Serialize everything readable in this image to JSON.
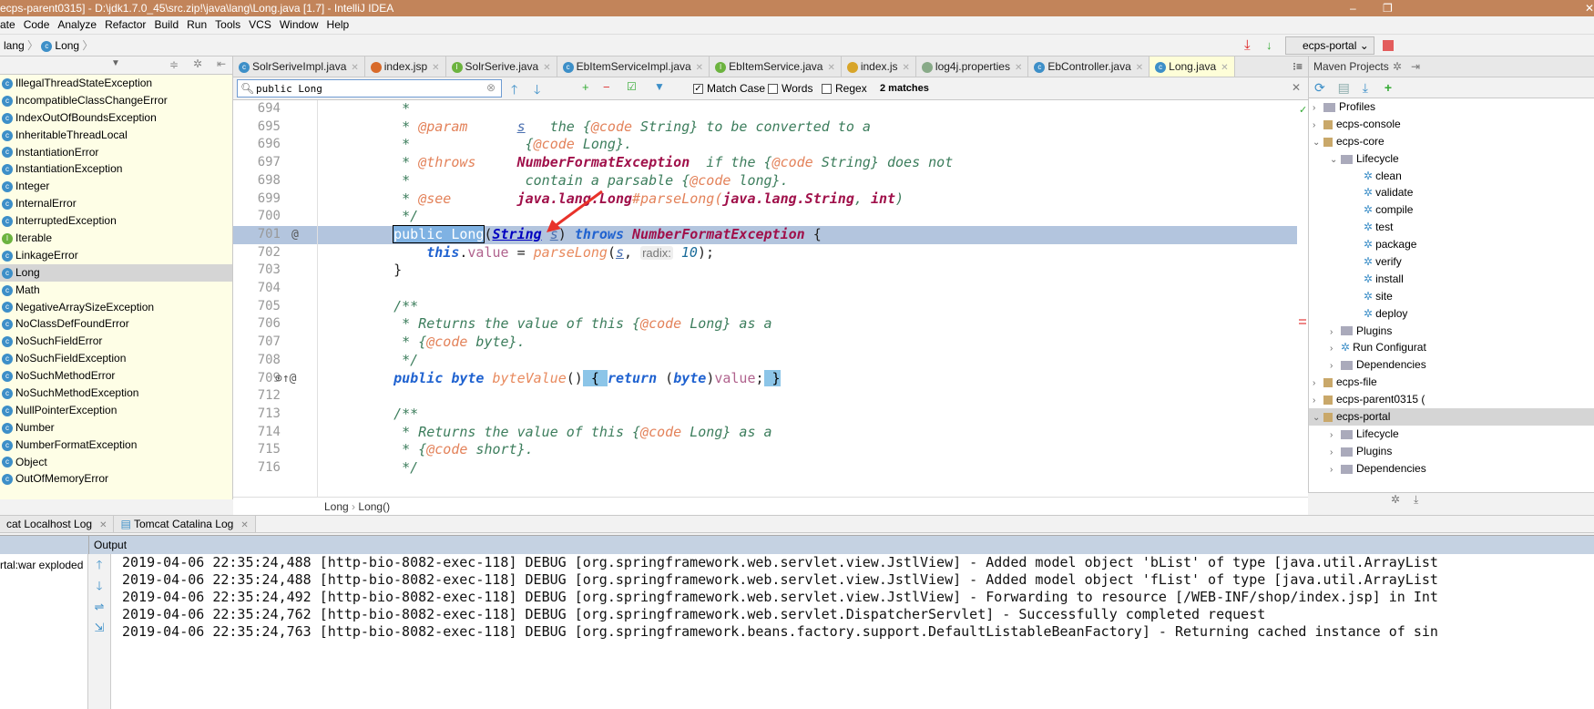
{
  "window": {
    "title": "ecps-parent0315] - D:\\jdk1.7.0_45\\src.zip!\\java\\lang\\Long.java [1.7] - IntelliJ IDEA",
    "minimize": "–",
    "restore": "❐",
    "close": "✕"
  },
  "menu": [
    "ate",
    "Code",
    "Analyze",
    "Refactor",
    "Build",
    "Run",
    "Tools",
    "VCS",
    "Window",
    "Help"
  ],
  "breadcrumb": {
    "items": [
      "lang",
      "Long"
    ],
    "run_config": "ecps-portal"
  },
  "left_panel": {
    "items": [
      "IllegalThreadStateException",
      "IncompatibleClassChangeError",
      "IndexOutOfBoundsException",
      "InheritableThreadLocal",
      "InstantiationError",
      "InstantiationException",
      "Integer",
      "InternalError",
      "InterruptedException",
      "Iterable",
      "LinkageError",
      "Long",
      "Math",
      "NegativeArraySizeException",
      "NoClassDefFoundError",
      "NoSuchFieldError",
      "NoSuchFieldException",
      "NoSuchMethodError",
      "NoSuchMethodException",
      "NullPointerException",
      "Number",
      "NumberFormatException",
      "Object",
      "OutOfMemoryError"
    ],
    "selected": "Long"
  },
  "tabs": [
    {
      "label": "SolrSeriveImpl.java",
      "icon": "c"
    },
    {
      "label": "index.jsp",
      "icon": "jsp"
    },
    {
      "label": "SolrSerive.java",
      "icon": "i"
    },
    {
      "label": "EbItemServiceImpl.java",
      "icon": "c"
    },
    {
      "label": "EbItemService.java",
      "icon": "i"
    },
    {
      "label": "index.js",
      "icon": "js"
    },
    {
      "label": "log4j.properties",
      "icon": "prop"
    },
    {
      "label": "EbController.java",
      "icon": "c"
    },
    {
      "label": "Long.java",
      "icon": "c",
      "active": true
    }
  ],
  "search": {
    "value": "public Long",
    "match_case": "Match Case",
    "match_case_checked": true,
    "words": "Words",
    "regex": "Regex",
    "result": "2 matches"
  },
  "code": [
    {
      "n": "694",
      "t": [
        [
          "cm",
          "     *"
        ]
      ]
    },
    {
      "n": "695",
      "t": [
        [
          "cm",
          "     * "
        ],
        [
          "tag",
          "@param"
        ],
        [
          "cm",
          "      "
        ],
        [
          "par",
          "s"
        ],
        [
          "cm",
          "   the {"
        ],
        [
          "tag",
          "@code"
        ],
        [
          "cm",
          " String} to be converted to a"
        ]
      ]
    },
    {
      "n": "696",
      "t": [
        [
          "cm",
          "     *              {"
        ],
        [
          "tag",
          "@code"
        ],
        [
          "cm",
          " Long}."
        ]
      ]
    },
    {
      "n": "697",
      "t": [
        [
          "cm",
          "     * "
        ],
        [
          "tag",
          "@throws"
        ],
        [
          "cm",
          "     "
        ],
        [
          "ref",
          "NumberFormatException"
        ],
        [
          "cm",
          "  if the {"
        ],
        [
          "tag",
          "@code"
        ],
        [
          "cm",
          " String} does not"
        ]
      ]
    },
    {
      "n": "698",
      "t": [
        [
          "cm",
          "     *              contain a parsable {"
        ],
        [
          "tag",
          "@code"
        ],
        [
          "cm",
          " long}."
        ]
      ]
    },
    {
      "n": "699",
      "t": [
        [
          "cm",
          "     * "
        ],
        [
          "tag",
          "@see"
        ],
        [
          "cm",
          "        "
        ],
        [
          "ref",
          "java.lang.Long"
        ],
        [
          "tag",
          "#parseLong("
        ],
        [
          "ref",
          "java.lang.String"
        ],
        [
          "cm",
          ", "
        ],
        [
          "ref",
          "int"
        ],
        [
          "cm",
          ")"
        ]
      ]
    },
    {
      "n": "700",
      "t": [
        [
          "cm",
          "     */"
        ]
      ]
    },
    {
      "n": "701",
      "hl": true,
      "g": "@",
      "t": [
        [
          "plain",
          "    "
        ],
        [
          "selm",
          "public Long"
        ],
        [
          "plain",
          "("
        ],
        [
          "cls",
          "String"
        ],
        [
          "plain",
          " "
        ],
        [
          "par",
          "s"
        ],
        [
          "plain",
          ") "
        ],
        [
          "kw",
          "throws"
        ],
        [
          "plain",
          " "
        ],
        [
          "ref",
          "NumberFormatException"
        ],
        [
          "plain",
          " {"
        ]
      ]
    },
    {
      "n": "702",
      "t": [
        [
          "plain",
          "        "
        ],
        [
          "kw",
          "this"
        ],
        [
          "plain",
          "."
        ],
        [
          "fld",
          "value"
        ],
        [
          "plain",
          " = "
        ],
        [
          "mth",
          "parseLong"
        ],
        [
          "plain",
          "("
        ],
        [
          "par",
          "s"
        ],
        [
          "plain",
          ", "
        ],
        [
          "hint",
          "radix:"
        ],
        [
          "num",
          " 10"
        ],
        [
          "plain",
          ");"
        ]
      ]
    },
    {
      "n": "703",
      "t": [
        [
          "plain",
          "    }"
        ]
      ]
    },
    {
      "n": "704",
      "t": []
    },
    {
      "n": "705",
      "t": [
        [
          "cm",
          "    /**"
        ]
      ]
    },
    {
      "n": "706",
      "t": [
        [
          "cm",
          "     * Returns the value of this {"
        ],
        [
          "tag",
          "@code"
        ],
        [
          "cm",
          " Long} as a"
        ]
      ]
    },
    {
      "n": "707",
      "t": [
        [
          "cm",
          "     * {"
        ],
        [
          "tag",
          "@code"
        ],
        [
          "cm",
          " byte}."
        ]
      ]
    },
    {
      "n": "708",
      "t": [
        [
          "cm",
          "     */"
        ]
      ]
    },
    {
      "n": "709",
      "g": "⊙↑@",
      "t": [
        [
          "plain",
          "    "
        ],
        [
          "kw",
          "public byte"
        ],
        [
          "plain",
          " "
        ],
        [
          "mth",
          "byteValue"
        ],
        [
          "plain",
          "()"
        ],
        [
          "brace",
          " { "
        ],
        [
          "kw",
          "return"
        ],
        [
          "plain",
          " ("
        ],
        [
          "kw",
          "byte"
        ],
        [
          "plain",
          ")"
        ],
        [
          "fld",
          "value"
        ],
        [
          "plain",
          ";"
        ],
        [
          "brace",
          " }"
        ]
      ]
    },
    {
      "n": "712",
      "t": []
    },
    {
      "n": "713",
      "t": [
        [
          "cm",
          "    /**"
        ]
      ]
    },
    {
      "n": "714",
      "t": [
        [
          "cm",
          "     * Returns the value of this {"
        ],
        [
          "tag",
          "@code"
        ],
        [
          "cm",
          " Long} as a"
        ]
      ]
    },
    {
      "n": "715",
      "t": [
        [
          "cm",
          "     * {"
        ],
        [
          "tag",
          "@code"
        ],
        [
          "cm",
          " short}."
        ]
      ]
    },
    {
      "n": "716",
      "t": [
        [
          "cm",
          "     */"
        ]
      ]
    }
  ],
  "editor_breadcrumb": [
    "Long",
    "Long()"
  ],
  "maven": {
    "title": "Maven Projects",
    "tree": [
      {
        "label": "Profiles",
        "depth": 0,
        "arrow": ">",
        "icon": "folder"
      },
      {
        "label": "ecps-console",
        "depth": 0,
        "arrow": ">",
        "icon": "module"
      },
      {
        "label": "ecps-core",
        "depth": 0,
        "arrow": "v",
        "icon": "module"
      },
      {
        "label": "Lifecycle",
        "depth": 1,
        "arrow": "v",
        "icon": "folder"
      },
      {
        "label": "clean",
        "depth": 2,
        "icon": "gear"
      },
      {
        "label": "validate",
        "depth": 2,
        "icon": "gear"
      },
      {
        "label": "compile",
        "depth": 2,
        "icon": "gear"
      },
      {
        "label": "test",
        "depth": 2,
        "icon": "gear"
      },
      {
        "label": "package",
        "depth": 2,
        "icon": "gear"
      },
      {
        "label": "verify",
        "depth": 2,
        "icon": "gear"
      },
      {
        "label": "install",
        "depth": 2,
        "icon": "gear"
      },
      {
        "label": "site",
        "depth": 2,
        "icon": "gear"
      },
      {
        "label": "deploy",
        "depth": 2,
        "icon": "gear"
      },
      {
        "label": "Plugins",
        "depth": 1,
        "arrow": ">",
        "icon": "folder"
      },
      {
        "label": "Run Configurat",
        "depth": 1,
        "arrow": ">",
        "icon": "gear"
      },
      {
        "label": "Dependencies",
        "depth": 1,
        "arrow": ">",
        "icon": "folder"
      },
      {
        "label": "ecps-file",
        "depth": 0,
        "arrow": ">",
        "icon": "module"
      },
      {
        "label": "ecps-parent0315 (",
        "depth": 0,
        "arrow": ">",
        "icon": "module"
      },
      {
        "label": "ecps-portal",
        "depth": 0,
        "arrow": "v",
        "icon": "module",
        "selected": true
      },
      {
        "label": "Lifecycle",
        "depth": 1,
        "arrow": ">",
        "icon": "folder"
      },
      {
        "label": "Plugins",
        "depth": 1,
        "arrow": ">",
        "icon": "folder"
      },
      {
        "label": "Dependencies",
        "depth": 1,
        "arrow": ">",
        "icon": "folder"
      }
    ]
  },
  "bottom": {
    "tabs": [
      "cat Localhost Log",
      "Tomcat Catalina Log"
    ],
    "output_label": "Output",
    "deployment": "rtal:war exploded",
    "log": [
      "2019-04-06 22:35:24,488 [http-bio-8082-exec-118] DEBUG [org.springframework.web.servlet.view.JstlView] - Added model object 'bList' of type [java.util.ArrayList",
      "2019-04-06 22:35:24,488 [http-bio-8082-exec-118] DEBUG [org.springframework.web.servlet.view.JstlView] - Added model object 'fList' of type [java.util.ArrayList",
      "2019-04-06 22:35:24,492 [http-bio-8082-exec-118] DEBUG [org.springframework.web.servlet.view.JstlView] - Forwarding to resource [/WEB-INF/shop/index.jsp] in Int",
      "2019-04-06 22:35:24,762 [http-bio-8082-exec-118] DEBUG [org.springframework.web.servlet.DispatcherServlet] - Successfully completed request",
      "2019-04-06 22:35:24,763 [http-bio-8082-exec-118] DEBUG [org.springframework.beans.factory.support.DefaultListableBeanFactory] - Returning cached instance of sin"
    ]
  },
  "colors": {
    "titlebar": "#c2845a",
    "highlight_line": "#b3c5de",
    "annotation_arrow": "#e8322a"
  }
}
